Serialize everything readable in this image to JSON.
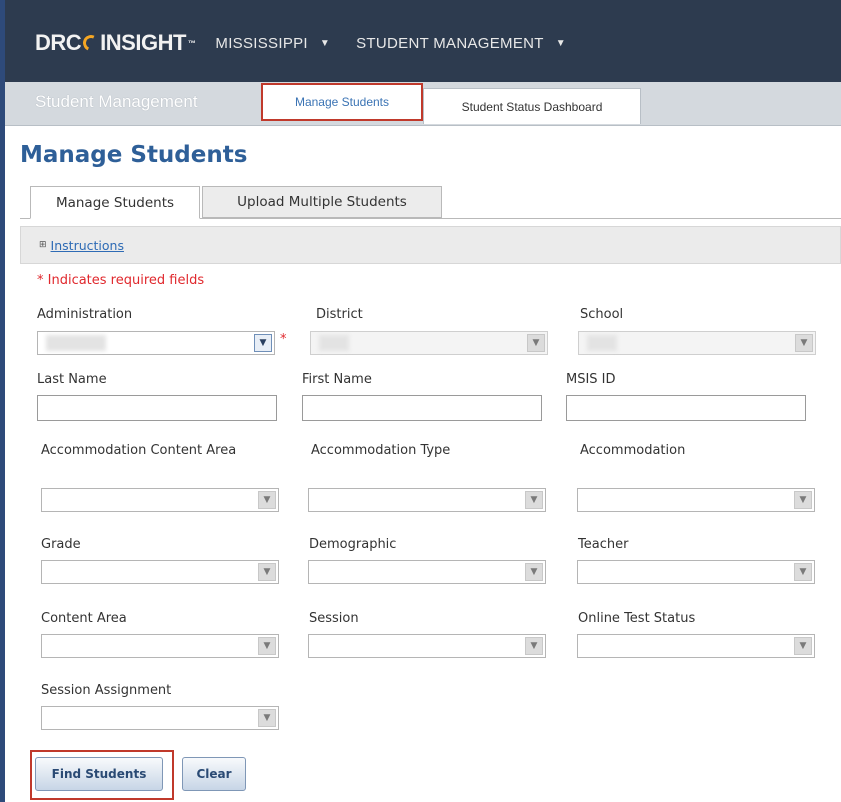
{
  "header": {
    "logo_left": "DRC",
    "logo_right": "INSIGHT",
    "logo_tm": "™",
    "menus": [
      {
        "label": "MISSISSIPPI"
      },
      {
        "label": "STUDENT MANAGEMENT"
      }
    ]
  },
  "subnav": {
    "title": "Student Management",
    "tabs": [
      {
        "label": "Manage Students",
        "active": true
      },
      {
        "label": "Student Status Dashboard",
        "active": false
      }
    ]
  },
  "page": {
    "title": "Manage Students",
    "tabs": [
      {
        "label": "Manage Students",
        "active": true
      },
      {
        "label": "Upload Multiple Students",
        "active": false
      }
    ],
    "instructions_toggle": "⊞",
    "instructions_link": "Instructions",
    "required_note": "* Indicates required fields",
    "required_marker": "*"
  },
  "form": {
    "administration_label": "Administration",
    "district_label": "District",
    "school_label": "School",
    "last_name_label": "Last Name",
    "first_name_label": "First Name",
    "msis_id_label": "MSIS ID",
    "accommodation_content_area_label": "Accommodation Content Area",
    "accommodation_type_label": "Accommodation Type",
    "accommodation_label": "Accommodation",
    "grade_label": "Grade",
    "demographic_label": "Demographic",
    "teacher_label": "Teacher",
    "content_area_label": "Content Area",
    "session_label": "Session",
    "online_test_status_label": "Online Test Status",
    "session_assignment_label": "Session Assignment"
  },
  "actions": {
    "find_label": "Find Students",
    "clear_label": "Clear"
  },
  "colors": {
    "topbar": "#2d3b4f",
    "title_blue": "#2e5f98",
    "required_red": "#e0282d",
    "highlight_red": "#c0392b"
  }
}
